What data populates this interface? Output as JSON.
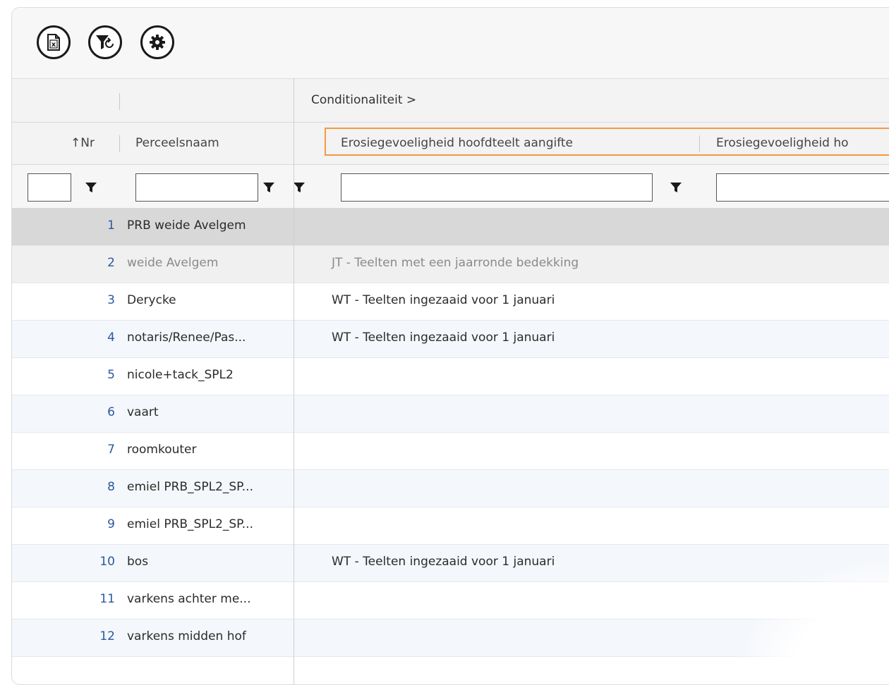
{
  "toolbar": {
    "buttons": [
      {
        "icon": "excel-export-icon"
      },
      {
        "icon": "filter-reset-icon"
      },
      {
        "icon": "settings-gear-icon"
      }
    ]
  },
  "header": {
    "group_label": "Conditionaliteit >",
    "columns": {
      "nr": "Nr",
      "naam": "Perceelsnaam",
      "erosie_aangifte": "Erosiegevoeligheid hoofdteelt aangifte",
      "erosie_ho": "Erosiegevoeligheid ho"
    },
    "sort_indicator": "↑"
  },
  "filters": {
    "nr_value": "",
    "naam_value": "",
    "erosie_aangifte_value": "",
    "erosie_ho_value": ""
  },
  "rows": [
    {
      "nr": "1",
      "naam": "PRB weide Avelgem",
      "cond": "",
      "state": "selected"
    },
    {
      "nr": "2",
      "naam": "weide Avelgem",
      "cond": "JT - Teelten met een jaarronde bedekking",
      "state": "grey"
    },
    {
      "nr": "3",
      "naam": "Derycke",
      "cond": "WT - Teelten ingezaaid voor 1 januari",
      "state": "white"
    },
    {
      "nr": "4",
      "naam": "notaris/Renee/Pas...",
      "cond": "WT - Teelten ingezaaid voor 1 januari",
      "state": "alt"
    },
    {
      "nr": "5",
      "naam": "nicole+tack_SPL2",
      "cond": "",
      "state": "white"
    },
    {
      "nr": "6",
      "naam": "vaart",
      "cond": "",
      "state": "alt"
    },
    {
      "nr": "7",
      "naam": "roomkouter",
      "cond": "",
      "state": "white"
    },
    {
      "nr": "8",
      "naam": "emiel PRB_SPL2_SP...",
      "cond": "",
      "state": "alt"
    },
    {
      "nr": "9",
      "naam": "emiel PRB_SPL2_SP...",
      "cond": "",
      "state": "white"
    },
    {
      "nr": "10",
      "naam": "bos",
      "cond": "WT - Teelten ingezaaid voor 1 januari",
      "state": "alt"
    },
    {
      "nr": "11",
      "naam": "varkens achter me...",
      "cond": "",
      "state": "white"
    },
    {
      "nr": "12",
      "naam": "varkens midden hof",
      "cond": "",
      "state": "alt"
    }
  ],
  "colors": {
    "highlight_border": "#f39a3c",
    "nr_text": "#2a59a0",
    "selected_row": "#d8d8d8"
  }
}
